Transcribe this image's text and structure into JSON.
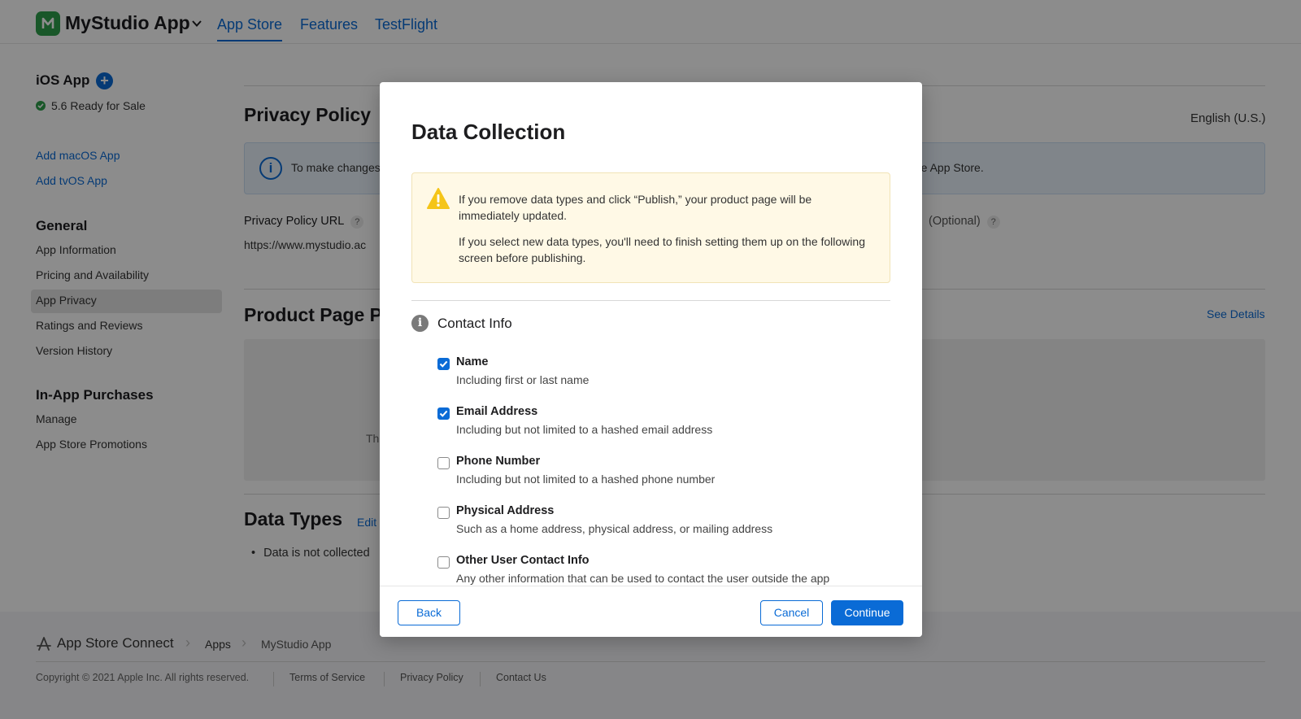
{
  "header": {
    "app_name": "MyStudio App",
    "tabs": [
      {
        "label": "App Store"
      },
      {
        "label": "Features"
      },
      {
        "label": "TestFlight"
      }
    ]
  },
  "sidebar": {
    "platform_title": "iOS App",
    "status": "5.6 Ready for Sale",
    "add_links": [
      "Add macOS App",
      "Add tvOS App"
    ],
    "general_title": "General",
    "general_items": [
      "App Information",
      "Pricing and Availability",
      "App Privacy",
      "Ratings and Reviews",
      "Version History"
    ],
    "iap_title": "In-App Purchases",
    "iap_items": [
      "Manage",
      "App Store Promotions"
    ]
  },
  "main": {
    "privacy_policy_title": "Privacy Policy",
    "language": "English (U.S.)",
    "info_banner_left": "To make changes",
    "info_banner_right": "the App Store.",
    "privacy_url_label": "Privacy Policy URL",
    "optional_label": "(Optional)",
    "privacy_url_value": "https://www.mystudio.ac",
    "product_page_title": "Product Page P",
    "see_details": "See Details",
    "placeholder_fragment": "Th",
    "data_types_title": "Data Types",
    "edit_link": "Edit",
    "data_not_collected": "Data is not collected"
  },
  "footer": {
    "brand": "App Store Connect",
    "breadcrumb": [
      "Apps",
      "MyStudio App"
    ],
    "copyright": "Copyright © 2021 Apple Inc. All rights reserved.",
    "links": [
      "Terms of Service",
      "Privacy Policy",
      "Contact Us"
    ]
  },
  "modal": {
    "title": "Data Collection",
    "warning_1": "If you remove data types and click “Publish,” your product page will be immediately updated.",
    "warning_2": "If you select new data types, you'll need to finish setting them up on the following screen before publishing.",
    "section_title": "Contact Info",
    "options": [
      {
        "label": "Name",
        "desc": "Including first or last name",
        "checked": true
      },
      {
        "label": "Email Address",
        "desc": "Including but not limited to a hashed email address",
        "checked": true
      },
      {
        "label": "Phone Number",
        "desc": "Including but not limited to a hashed phone number",
        "checked": false
      },
      {
        "label": "Physical Address",
        "desc": "Such as a home address, physical address, or mailing address",
        "checked": false
      },
      {
        "label": "Other User Contact Info",
        "desc": "Any other information that can be used to contact the user outside the app",
        "checked": false
      }
    ],
    "back_label": "Back",
    "cancel_label": "Cancel",
    "continue_label": "Continue"
  },
  "colors": {
    "accent": "#0a6bd6",
    "status_green": "#2f9e4b",
    "warning_bg": "#fff9e6",
    "warning_icon": "#f5c518"
  }
}
